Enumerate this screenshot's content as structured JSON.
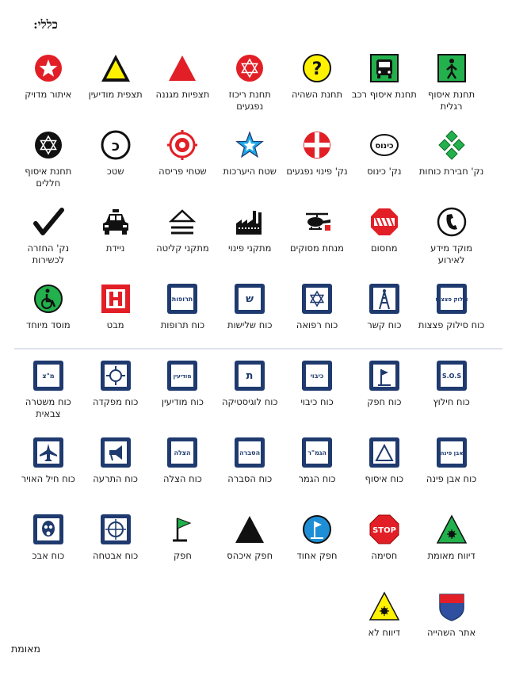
{
  "title": "כללי:",
  "rows": [
    [
      {
        "label": "תחנת איסוף רגלית",
        "icon": "pedestrian-collection-icon"
      },
      {
        "label": "תחנת איסוף רכב",
        "icon": "bus-collection-icon"
      },
      {
        "label": "תחנת השהיה",
        "icon": "question-mark-icon"
      },
      {
        "label": "תחנת ריכוז נפגעים",
        "icon": "casualty-star-icon"
      },
      {
        "label": "תצפיות מגננה",
        "icon": "red-triangle-icon"
      },
      {
        "label": "תצפית מודיעין",
        "icon": "yellow-triangle-icon"
      },
      {
        "label": "איתור מדויק",
        "icon": "red-star-circle-icon"
      }
    ],
    [
      {
        "label": "נק' חבירת כוחות",
        "icon": "green-diamonds-icon"
      },
      {
        "label": "נק' כינוס",
        "icon": "assembly-point-icon"
      },
      {
        "label": "נק' פינוי נפגעים",
        "icon": "red-cross-circle-icon"
      },
      {
        "label": "שטח היערכות",
        "icon": "blue-star-icon"
      },
      {
        "label": "שטחי פריסה",
        "icon": "deployment-target-icon"
      },
      {
        "label": "שטכ",
        "icon": "black-c-circle-icon"
      },
      {
        "label": "תחנת איסוף חללים",
        "icon": "black-star-circle-icon"
      }
    ],
    [
      {
        "label": "מוקד מידע לאירוע",
        "icon": "phone-icon"
      },
      {
        "label": "מחסום",
        "icon": "roadblock-icon"
      },
      {
        "label": "מנחת מסוקים",
        "icon": "helicopter-icon"
      },
      {
        "label": "מתקני פינוי",
        "icon": "factory-icon"
      },
      {
        "label": "מתקני קליטה",
        "icon": "eject-icon"
      },
      {
        "label": "ניידת",
        "icon": "police-car-icon"
      },
      {
        "label": "נק' החזרה לכשירות",
        "icon": "checkmark-icon"
      }
    ],
    [
      {
        "label": "כוח סילוק פצצות",
        "icon": "bomb-disposal-icon",
        "text": "סילוק פצצות"
      },
      {
        "label": "כוח קשר",
        "icon": "communication-tower-icon"
      },
      {
        "label": "כוח רפואה",
        "icon": "medical-star-icon"
      },
      {
        "label": "כוח שלישות",
        "icon": "adjutancy-icon",
        "text": "ש"
      },
      {
        "label": "כוח תרופות",
        "icon": "medicines-icon",
        "text": "תרופות"
      },
      {
        "label": "מבט",
        "icon": "h-icon"
      },
      {
        "label": "מוסד מיוחד",
        "icon": "wheelchair-icon"
      }
    ],
    [
      {
        "label": "כוח חילוץ",
        "icon": "sos-icon",
        "text": "S.O.S"
      },
      {
        "label": "כוח חפק",
        "icon": "field-command-icon"
      },
      {
        "label": "כוח כיבוי",
        "icon": "firefighting-icon",
        "text": "כיבוי"
      },
      {
        "label": "כוח לוגיסטיקה",
        "icon": "logistics-icon",
        "text": "ת"
      },
      {
        "label": "כוח מודיעין",
        "icon": "intelligence-icon",
        "text": "מודיעין"
      },
      {
        "label": "כוח מפקדה",
        "icon": "headquarters-icon"
      },
      {
        "label": "כוח משטרה צבאית",
        "icon": "military-police-icon",
        "text": "מ\"צ"
      }
    ],
    [
      {
        "label": "כוח אבן פינה",
        "icon": "cornerstone-icon",
        "text": "אבן פינה"
      },
      {
        "label": "כוח איסוף",
        "icon": "collection-triangle-icon"
      },
      {
        "label": "כוח הגמר",
        "icon": "completion-icon",
        "text": "הגמ\"ר"
      },
      {
        "label": "כוח הסברה",
        "icon": "information-icon",
        "text": "הסברה"
      },
      {
        "label": "כוח הצלה",
        "icon": "rescue-icon",
        "text": "הצלה"
      },
      {
        "label": "כוח התרעה",
        "icon": "megaphone-icon"
      },
      {
        "label": "כוח חיל האויר",
        "icon": "airforce-icon"
      }
    ],
    [
      {
        "label": "דיווח מאומת",
        "icon": "verified-report-icon"
      },
      {
        "label": "חסימה",
        "icon": "stop-sign-icon",
        "text": "STOP"
      },
      {
        "label": "חפק אחוד",
        "icon": "unified-command-flag-icon"
      },
      {
        "label": "חפק איכהס",
        "icon": "black-triangle-icon"
      },
      {
        "label": "חפק",
        "icon": "green-flag-icon"
      },
      {
        "label": "כוח אבטחה",
        "icon": "crosshair-icon"
      },
      {
        "label": "כוח אבכ",
        "icon": "gas-mask-icon"
      }
    ],
    [
      {
        "label": "אתר השהייה",
        "icon": "shield-icon"
      },
      {
        "label": "דיווח לא",
        "icon": "unverified-report-icon"
      }
    ]
  ],
  "footnote": "מאומת",
  "colors": {
    "navy": "#1f3a6e",
    "red": "#e21f26",
    "green": "#22b14c",
    "yellow": "#fff200",
    "blue": "#1e8fd6"
  }
}
